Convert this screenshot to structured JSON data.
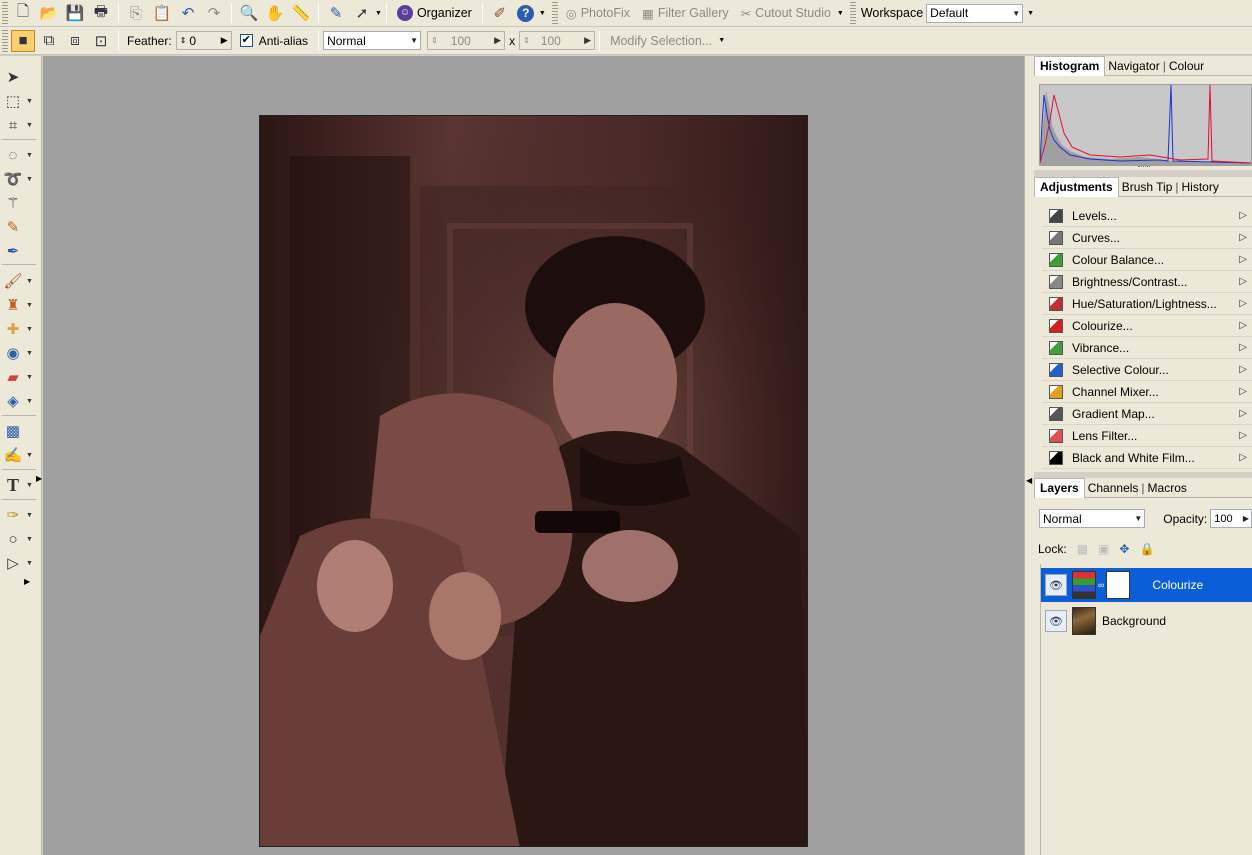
{
  "toolbar": {
    "organizer_label": "Organizer",
    "photofix_label": "PhotoFix",
    "filter_gallery_label": "Filter Gallery",
    "cutout_studio_label": "Cutout Studio",
    "workspace_label": "Workspace",
    "workspace_value": "Default"
  },
  "options": {
    "feather_label": "Feather:",
    "feather_value": "0",
    "antialias_label": "Anti-alias",
    "antialias_checked": true,
    "style_value": "Normal",
    "width_value": "100",
    "times_label": "x",
    "height_value": "100",
    "modify_selection_label": "Modify Selection..."
  },
  "panels": {
    "histogram_tabs": [
      "Histogram",
      "Navigator",
      "Colour"
    ],
    "adjustment_tabs": [
      "Adjustments",
      "Brush Tip",
      "History"
    ],
    "adjustments": [
      {
        "label": "Levels...",
        "icon": "levels-icon",
        "color": "#444444"
      },
      {
        "label": "Curves...",
        "icon": "curves-icon",
        "color": "#777777"
      },
      {
        "label": "Colour Balance...",
        "icon": "colour-balance-icon",
        "color": "#3aa03a"
      },
      {
        "label": "Brightness/Contrast...",
        "icon": "brightness-icon",
        "color": "#888888"
      },
      {
        "label": "Hue/Saturation/Lightness...",
        "icon": "hue-saturation-icon",
        "color": "#c03030"
      },
      {
        "label": "Colourize...",
        "icon": "colourize-icon",
        "color": "#d02020"
      },
      {
        "label": "Vibrance...",
        "icon": "vibrance-icon",
        "color": "#40a040"
      },
      {
        "label": "Selective Colour...",
        "icon": "selective-colour-icon",
        "color": "#2060d0"
      },
      {
        "label": "Channel Mixer...",
        "icon": "channel-mixer-icon",
        "color": "#e0a020"
      },
      {
        "label": "Gradient Map...",
        "icon": "gradient-map-icon",
        "color": "#555555"
      },
      {
        "label": "Lens Filter...",
        "icon": "lens-filter-icon",
        "color": "#e05050"
      },
      {
        "label": "Black and White Film...",
        "icon": "black-white-icon",
        "color": "#000000"
      }
    ],
    "layers_tabs": [
      "Layers",
      "Channels",
      "Macros"
    ],
    "blend_mode": "Normal",
    "opacity_label": "Opacity:",
    "opacity_value": "100",
    "lock_label": "Lock:",
    "layers": [
      {
        "name": "Colourize",
        "selected": true
      },
      {
        "name": "Background",
        "selected": false
      }
    ]
  }
}
